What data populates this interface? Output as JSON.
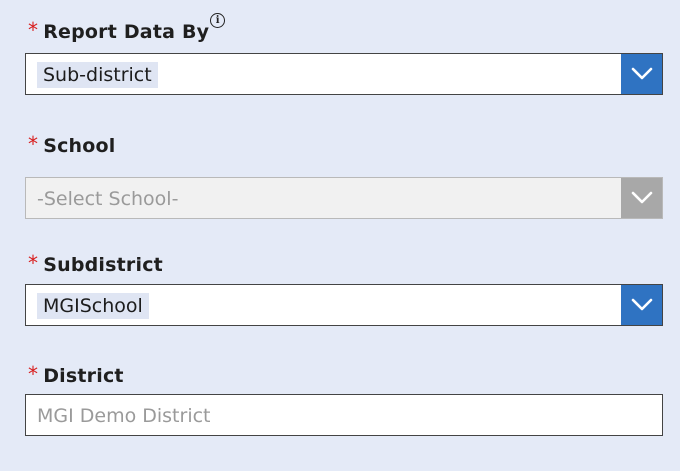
{
  "report_data_by": {
    "required_mark": "*",
    "label": "Report Data By",
    "info_icon": "i",
    "value": "Sub-district"
  },
  "school": {
    "required_mark": "*",
    "label": "School",
    "placeholder": "-Select School-",
    "disabled": true
  },
  "subdistrict": {
    "required_mark": "*",
    "label": "Subdistrict",
    "value": "MGISchool"
  },
  "district": {
    "required_mark": "*",
    "label": "District",
    "placeholder": "MGI Demo District"
  },
  "colors": {
    "panel_background": "#e4eaf7",
    "required": "#d81e1e",
    "dropdown_button": "#2f73c2",
    "dropdown_button_disabled": "#a8a8a8"
  },
  "icons": {
    "dropdown": "chevron-down-icon",
    "info": "info-icon"
  }
}
